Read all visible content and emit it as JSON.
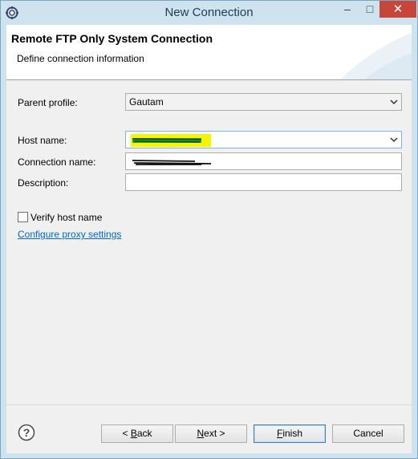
{
  "window": {
    "title": "New Connection",
    "icon": "eclipse-gear-icon",
    "minimize_glyph": "–",
    "maximize_glyph": "□",
    "close_glyph": "✕",
    "accent": "#cfe3ef",
    "close_color": "#c7463a"
  },
  "banner": {
    "title": "Remote FTP Only System Connection",
    "description": "Define connection information"
  },
  "form": {
    "parent_profile": {
      "label": "Parent profile:",
      "value": "Gautam"
    },
    "host_name": {
      "label": "Host name:",
      "value": ""
    },
    "connection_name": {
      "label": "Connection name:",
      "value": ""
    },
    "description": {
      "label": "Description:",
      "value": ""
    },
    "verify_host": {
      "label": "Verify host name",
      "checked": false
    },
    "proxy_link": "Configure proxy settings"
  },
  "buttons": {
    "back_prefix": "< ",
    "back_mnemonic": "B",
    "back_rest": "ack",
    "next_mnemonic": "N",
    "next_rest": "ext >",
    "finish_mnemonic": "F",
    "finish_rest": "inish",
    "cancel": "Cancel"
  },
  "colors": {
    "link": "#0066cc",
    "highlight_yellow": "#f5f500",
    "highlight_green": "#2a9a2a"
  }
}
